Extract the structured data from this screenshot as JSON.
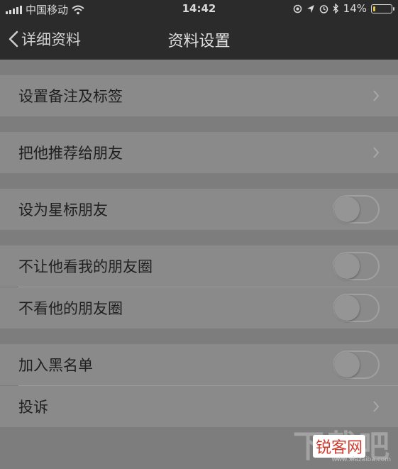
{
  "statusbar": {
    "carrier": "中国移动",
    "time": "14:42",
    "battery_text": "14%",
    "battery_level": 0.14,
    "icons": [
      "signal-icon",
      "wifi-icon",
      "location-icon",
      "alarm-icon",
      "bluetooth-icon",
      "battery-icon"
    ]
  },
  "navbar": {
    "back_label": "详细资料",
    "title": "资料设置"
  },
  "rows": {
    "remark": "设置备注及标签",
    "recommend": "把他推荐给朋友",
    "star": "设为星标朋友",
    "hide_moments": "不让他看我的朋友圈",
    "not_view_moments": "不看他的朋友圈",
    "blacklist": "加入黑名单",
    "complain": "投诉"
  },
  "toggles": {
    "star": false,
    "hide_moments": false,
    "not_view_moments": false,
    "blacklist": false
  },
  "watermark": {
    "big": "下载吧",
    "brand": "锐客网",
    "url": "www.xiazaiba.com"
  }
}
